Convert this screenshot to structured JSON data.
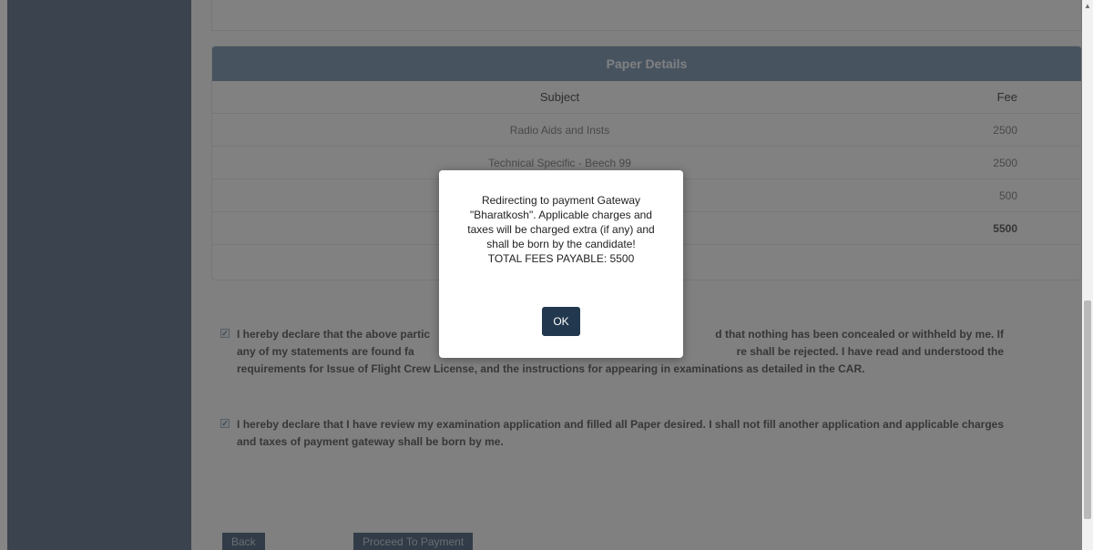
{
  "paper_details": {
    "header": "Paper Details",
    "columns": {
      "subject": "Subject",
      "fee": "Fee"
    },
    "rows": [
      {
        "subject": "Radio Aids and Insts",
        "fee": "2500"
      },
      {
        "subject": "Technical Specific - Beech 99",
        "fee": "2500"
      },
      {
        "subject": "",
        "fee": "500"
      }
    ],
    "total": {
      "subject": "",
      "fee": "5500"
    }
  },
  "declarations": {
    "d1": "I hereby declare that the above partic... nothing has been concealed or withheld by me. If any of my statements are found f... shall be rejected. I have read and understood the requirements for Issue of Flight Crew License, and the instructions for appearing in examinations as detailed in the CAR.",
    "d1_parts": {
      "line1_left": "I hereby declare that the above partic",
      "line1_right": "d that nothing has been concealed or withheld by me. If",
      "line2_left": "any of my statements are found fa",
      "line2_right": "re shall be rejected. I have read and understood the",
      "line3": "requirements for Issue of Flight Crew License, and the instructions for appearing in examinations as detailed in the CAR."
    },
    "d2": "I hereby declare that I have review my examination application and filled all Paper desired. I shall not fill another application and applicable charges and taxes of payment gateway shall be born by me."
  },
  "buttons": {
    "back": "Back",
    "proceed": "Proceed To Payment"
  },
  "modal": {
    "line1": "Redirecting to payment Gateway",
    "line2": "\"Bharatkosh\". Applicable charges and",
    "line3": "taxes will be charged extra (if any) and",
    "line4": "shall be born by the candidate!",
    "line5": "TOTAL FEES PAYABLE: 5500",
    "ok": "OK"
  },
  "colors": {
    "sidebar": "#6f8196",
    "header": "#8aa0b8",
    "ok_button": "#22384e"
  }
}
